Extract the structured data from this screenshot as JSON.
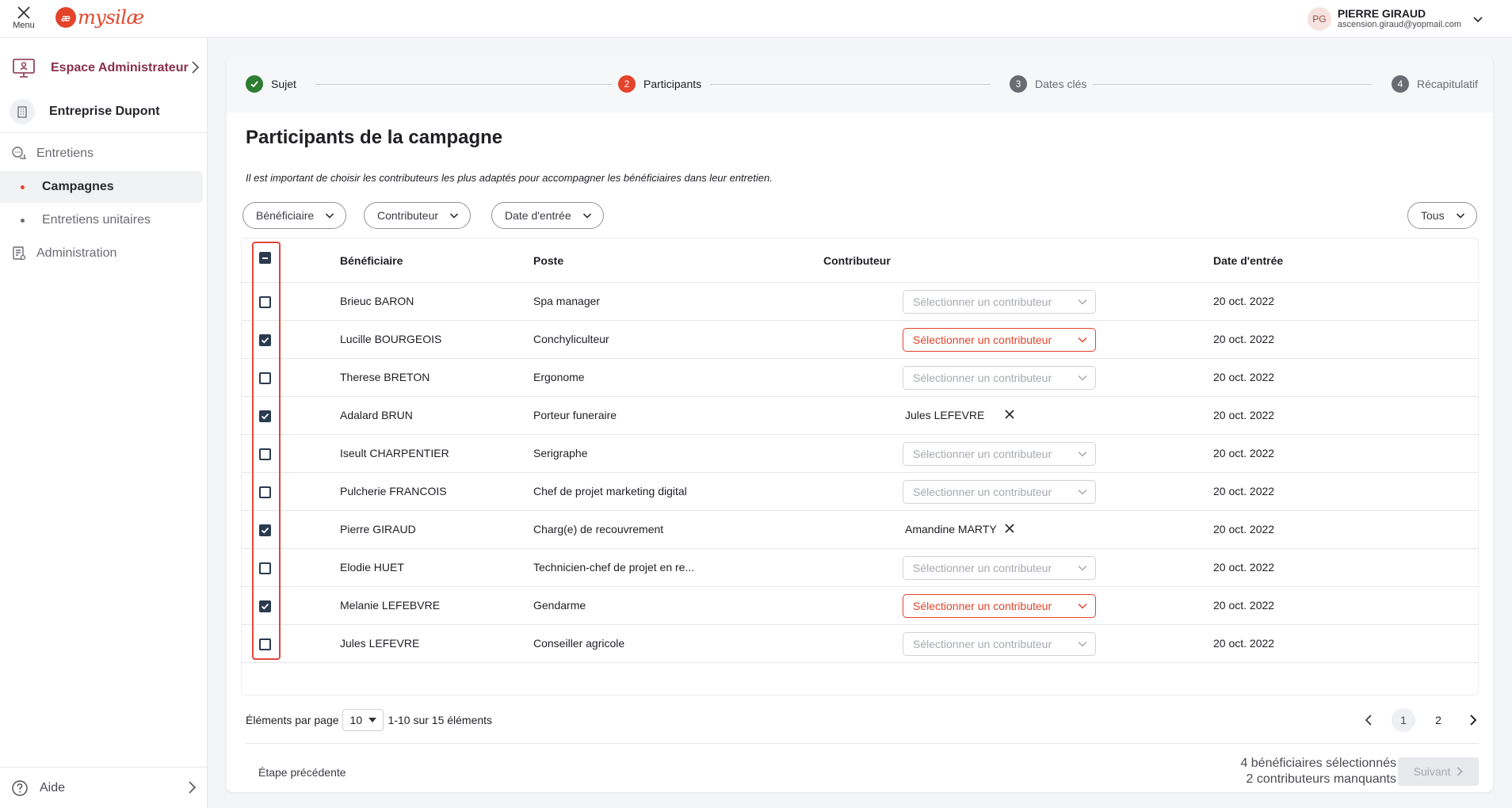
{
  "topbar": {
    "menu_label": "Menu",
    "logo_mark": "æ",
    "logo_text": "mysilæ",
    "user_initials": "PG",
    "user_name": "PIERRE GIRAUD",
    "user_email": "ascension.giraud@yopmail.com"
  },
  "sidebar": {
    "space_label": "Espace Administrateur",
    "company": "Entreprise Dupont",
    "items": [
      {
        "label": "Entretiens",
        "active": false
      },
      {
        "label": "Campagnes",
        "active": true
      },
      {
        "label": "Entretiens unitaires",
        "active": false
      },
      {
        "label": "Administration",
        "active": false
      }
    ],
    "help_label": "Aide"
  },
  "stepper": {
    "steps": [
      {
        "num": "",
        "label": "Sujet",
        "state": "done"
      },
      {
        "num": "2",
        "label": "Participants",
        "state": "current"
      },
      {
        "num": "3",
        "label": "Dates clés",
        "state": "todo"
      },
      {
        "num": "4",
        "label": "Récapitulatif",
        "state": "todo"
      }
    ]
  },
  "page": {
    "title": "Participants de la campagne",
    "description": "Il est important de choisir les contributeurs les plus adaptés pour accompagner les bénéficiaires dans leur entretien."
  },
  "filters": {
    "beneficiaire": "Bénéficiaire",
    "contributeur": "Contributeur",
    "date_entree": "Date d'entrée",
    "tous": "Tous"
  },
  "table": {
    "headers": {
      "beneficiaire": "Bénéficiaire",
      "poste": "Poste",
      "contributeur": "Contributeur",
      "date": "Date d'entrée"
    },
    "select_placeholder": "Sélectionner un contributeur",
    "rows": [
      {
        "name": "Brieuc BARON",
        "poste": "Spa manager",
        "checked": false,
        "contrib": "",
        "error": false,
        "date": "20 oct. 2022"
      },
      {
        "name": "Lucille BOURGEOIS",
        "poste": "Conchyliculteur",
        "checked": true,
        "contrib": "",
        "error": true,
        "date": "20 oct. 2022"
      },
      {
        "name": "Therese BRETON",
        "poste": "Ergonome",
        "checked": false,
        "contrib": "",
        "error": false,
        "date": "20 oct. 2022"
      },
      {
        "name": "Adalard BRUN",
        "poste": "Porteur funeraire",
        "checked": true,
        "contrib": "Jules LEFEVRE",
        "error": false,
        "date": "20 oct. 2022"
      },
      {
        "name": "Iseult CHARPENTIER",
        "poste": "Serigraphe",
        "checked": false,
        "contrib": "",
        "error": false,
        "date": "20 oct. 2022"
      },
      {
        "name": "Pulcherie FRANCOIS",
        "poste": "Chef de projet marketing digital",
        "checked": false,
        "contrib": "",
        "error": false,
        "date": "20 oct. 2022"
      },
      {
        "name": "Pierre GIRAUD",
        "poste": "Charg(e) de recouvrement",
        "checked": true,
        "contrib": "Amandine MARTY",
        "error": false,
        "date": "20 oct. 2022"
      },
      {
        "name": "Elodie HUET",
        "poste": "Technicien-chef de projet en re...",
        "checked": false,
        "contrib": "",
        "error": false,
        "date": "20 oct. 2022"
      },
      {
        "name": "Melanie LEFEBVRE",
        "poste": "Gendarme",
        "checked": true,
        "contrib": "",
        "error": true,
        "date": "20 oct. 2022"
      },
      {
        "name": "Jules LEFEVRE",
        "poste": "Conseiller agricole",
        "checked": false,
        "contrib": "",
        "error": false,
        "date": "20 oct. 2022"
      }
    ]
  },
  "pagination": {
    "per_page_label": "Éléments par page",
    "per_page": "10",
    "range": "1-10 sur 15 éléments",
    "pages": [
      "1",
      "2"
    ],
    "current": "1"
  },
  "footer": {
    "prev_step": "Étape précédente",
    "selected_summary": "4 bénéficiaires sélectionnés",
    "missing_summary": "2 contributeurs manquants",
    "next_label": "Suivant"
  },
  "colors": {
    "accent": "#e4442a",
    "brand_purple": "#8a2f4a",
    "done_green": "#2e7d32",
    "checkbox_navy": "#2a3a4f"
  }
}
